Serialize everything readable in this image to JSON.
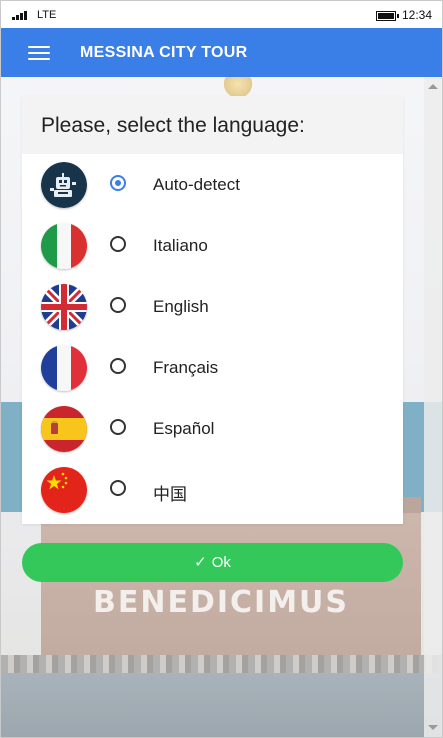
{
  "status_bar": {
    "network": "LTE",
    "time": "12:34"
  },
  "app_bar": {
    "title": "MESSINA CITY TOUR"
  },
  "background": {
    "building_text": "BENEDICIMUS"
  },
  "dialog": {
    "title": "Please, select the language:",
    "selected": "auto-detect",
    "options": [
      {
        "id": "auto-detect",
        "label": "Auto-detect",
        "icon": "robot-icon",
        "selected": true
      },
      {
        "id": "italiano",
        "label": "Italiano",
        "icon": "italy-flag-icon",
        "selected": false
      },
      {
        "id": "english",
        "label": "English",
        "icon": "uk-flag-icon",
        "selected": false
      },
      {
        "id": "francais",
        "label": "Français",
        "icon": "france-flag-icon",
        "selected": false
      },
      {
        "id": "espanol",
        "label": "Español",
        "icon": "spain-flag-icon",
        "selected": false
      },
      {
        "id": "chinese",
        "label": "中国",
        "icon": "china-flag-icon",
        "selected": false
      }
    ]
  },
  "ok_button": {
    "label": "Ok",
    "icon": "checkmark-icon"
  },
  "colors": {
    "app_bar": "#3a7ee8",
    "ok_button": "#34c85a",
    "radio_selected": "#3a7ee8"
  }
}
